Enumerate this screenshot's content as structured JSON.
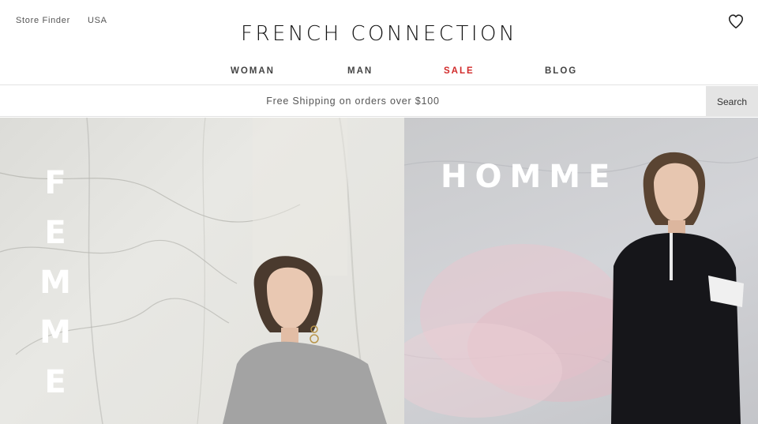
{
  "header": {
    "util_links": [
      "Store Finder",
      "USA"
    ],
    "logo": "FRENCH CONNECTION",
    "wishlist_icon": "heart-icon"
  },
  "nav": {
    "items": [
      {
        "label": "WOMAN"
      },
      {
        "label": "MAN"
      },
      {
        "label": "SALE",
        "color": "#d12a2a"
      },
      {
        "label": "BLOG"
      }
    ]
  },
  "promo": {
    "text": "Free Shipping on orders over $100",
    "search_label": "Search"
  },
  "hero": {
    "femme_letters": [
      "F",
      "E",
      "M",
      "M",
      "E"
    ],
    "homme": "HOMME"
  }
}
